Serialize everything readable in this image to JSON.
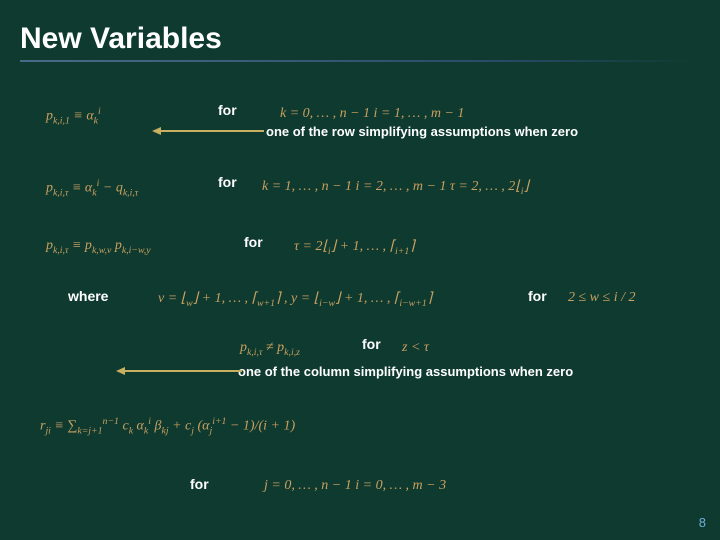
{
  "title": "New Variables",
  "lines": {
    "line1": {
      "eq": "p<sub>k,i,1</sub> ≡ α<sub>k</sub><sup>i</sup>",
      "for": "for",
      "range": "k = 0, … , n − 1      i = 1, … , m − 1",
      "note": "one of the row simplifying assumptions when zero"
    },
    "line2": {
      "eq": "p<sub>k,i,τ</sub> ≡ α<sub>k</sub><sup>i</sup> − q<sub>k,i,τ</sub>",
      "for": "for",
      "range": "k = 1, … , n − 1     i = 2, … , m − 1     τ = 2, … , 2⌊<sub>i</sub>⌋"
    },
    "line3": {
      "eq": "p<sub>k,i,τ</sub> ≡ p<sub>k,w,ν</sub> p<sub>k,i−w,y</sub>",
      "for": "for",
      "range": "τ = 2⌊<sub>i</sub>⌋ + 1, … , ⌈<sub>i+1</sub>⌉"
    },
    "whereLine": {
      "where": "where",
      "range": "ν = ⌊<sub>w</sub>⌋ + 1, … , ⌈<sub>w+1</sub>⌉ ,   y = ⌊<sub>i−w</sub>⌋ + 1, … , ⌈<sub>i−w+1</sub>⌉",
      "for": "for",
      "cond": "2 ≤ w ≤ i / 2"
    },
    "line4": {
      "ineq": "p<sub>k,i,τ</sub> ≠ p<sub>k,i,z</sub>",
      "for": "for",
      "cond": "z < τ",
      "note": "one of the column simplifying assumptions when zero"
    },
    "line5": {
      "eq": "r<sub>ji</sub> ≡ ∑<sub>k=j+1</sub><sup>n−1</sup> c<sub>k</sub> α<sub>k</sub><sup>i</sup> β<sub>kj</sub> + c<sub>j</sub> (α<sub>j</sub><sup>i+1</sup> − 1)/(i + 1)"
    },
    "line6": {
      "for": "for",
      "range": "j = 0, … , n − 1      i = 0, … , m − 3"
    }
  },
  "pagenum": "8"
}
